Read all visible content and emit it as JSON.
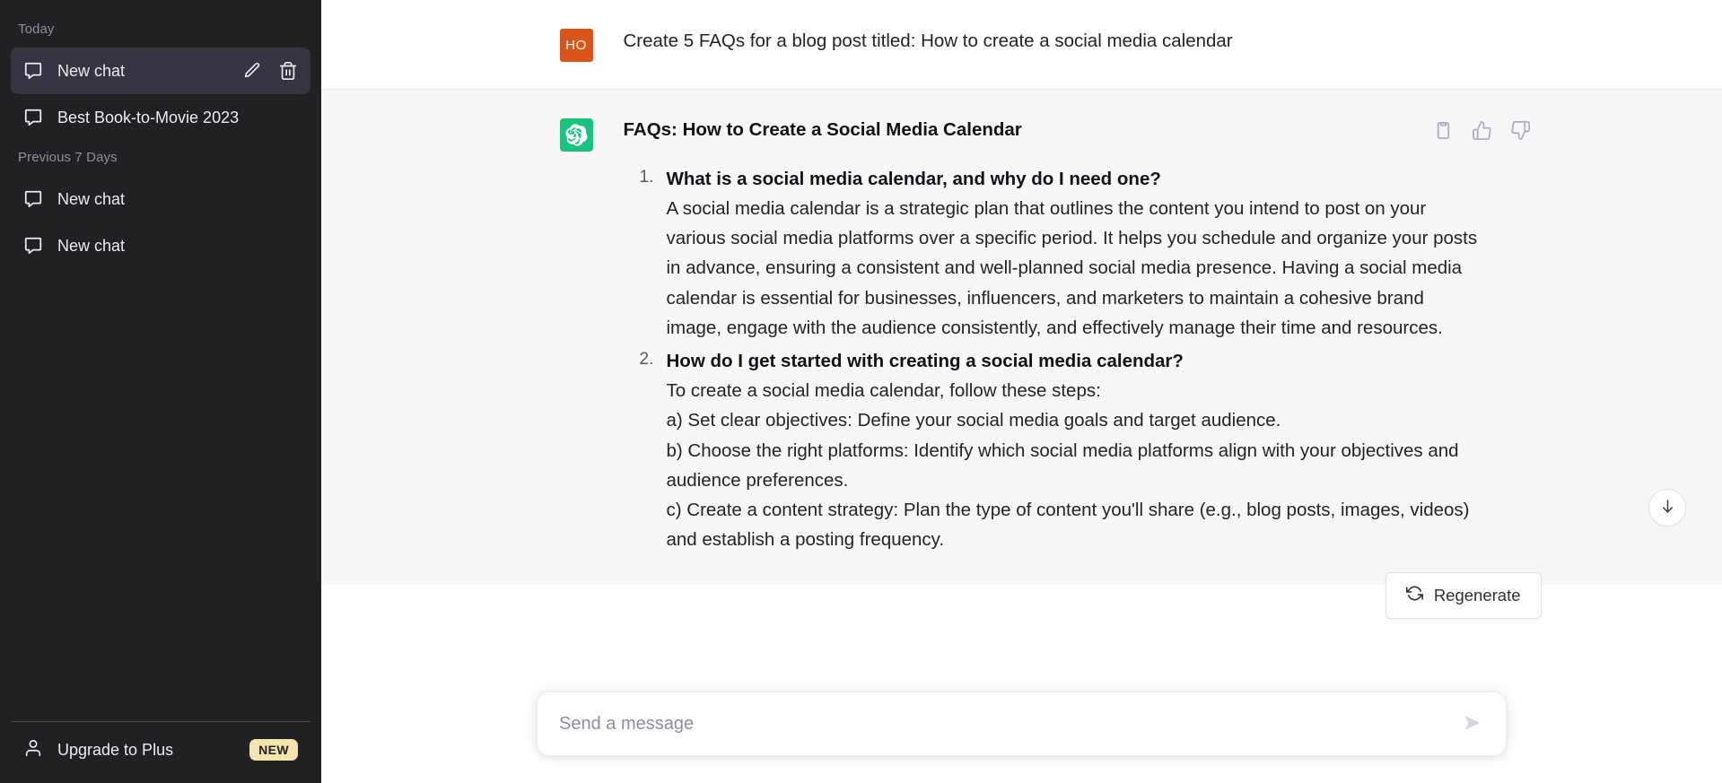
{
  "sidebar": {
    "groups": [
      {
        "label": "Today",
        "items": [
          {
            "title": "New chat",
            "icon": "chat-bubble-icon",
            "active": true,
            "actions": [
              {
                "name": "edit-chat-icon"
              },
              {
                "name": "delete-chat-icon"
              }
            ]
          },
          {
            "title": "Best Book-to-Movie 2023",
            "icon": "chat-bubble-icon",
            "active": false,
            "actions": []
          }
        ]
      },
      {
        "label": "Previous 7 Days",
        "items": [
          {
            "title": "New chat",
            "icon": "chat-bubble-icon",
            "active": false,
            "actions": []
          },
          {
            "title": "New chat",
            "icon": "chat-bubble-icon",
            "active": false,
            "actions": []
          }
        ]
      }
    ],
    "footer": {
      "upgrade_label": "Upgrade to Plus",
      "upgrade_icon": "person-icon",
      "badge": "NEW",
      "badge_color": "#f4e4ad"
    },
    "background_color": "#202123",
    "active_item_color": "#343541"
  },
  "conversation": {
    "user_message": {
      "avatar_initials": "HO",
      "avatar_color": "#d9541a",
      "text": "Create 5 FAQs for a blog post titled: How to create a social media calendar"
    },
    "assistant_message": {
      "avatar_icon": "chatgpt-logo-icon",
      "avatar_color": "#19c37d",
      "title": "FAQs: How to Create a Social Media Calendar",
      "items": [
        {
          "number": "1.",
          "question": "What is a social media calendar, and why do I need one?",
          "paragraphs": [
            "A social media calendar is a strategic plan that outlines the content you intend to post on your various social media platforms over a specific period. It helps you schedule and organize your posts in advance, ensuring a consistent and well-planned social media presence. Having a social media calendar is essential for businesses, influencers, and marketers to maintain a cohesive brand image, engage with the audience consistently, and effectively manage their time and resources."
          ]
        },
        {
          "number": "2.",
          "question": "How do I get started with creating a social media calendar?",
          "paragraphs": [
            "To create a social media calendar, follow these steps:",
            "a) Set clear objectives: Define your social media goals and target audience.",
            "b) Choose the right platforms: Identify which social media platforms align with your objectives and audience preferences.",
            "c) Create a content strategy: Plan the type of content you'll share (e.g., blog posts, images, videos) and establish a posting frequency."
          ]
        }
      ],
      "tools": [
        {
          "name": "copy-icon"
        },
        {
          "name": "thumbs-up-icon"
        },
        {
          "name": "thumbs-down-icon"
        }
      ]
    }
  },
  "actions": {
    "regenerate_label": "Regenerate",
    "regenerate_icon": "refresh-icon",
    "scroll_to_bottom_icon": "arrow-down-icon"
  },
  "composer": {
    "placeholder": "Send a message",
    "value": "",
    "send_icon": "send-arrow-icon"
  }
}
